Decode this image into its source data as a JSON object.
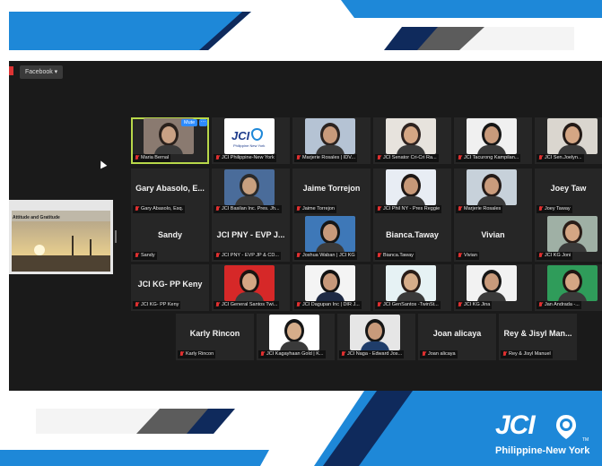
{
  "toolbar": {
    "facebook_label": "Facebook ▾"
  },
  "shared_screen": {
    "slide_title": "Attitude and Gratitude"
  },
  "tiles": [
    {
      "label": "Maria Bernal",
      "active": true,
      "mute": "Mute",
      "more": "···"
    },
    {
      "label": "JCI Philippine-New York"
    },
    {
      "label": "Marjerie Rosales | IDV..."
    },
    {
      "label": "JCI Senator Cri-Cri Ra..."
    },
    {
      "label": "JCI Tacurong Kampilan..."
    },
    {
      "label": "JCI Sen.Joelyn..."
    },
    {
      "big": "Gary Abasolo, E...",
      "label": "Gary Abasolo, Esq."
    },
    {
      "label": "JCI Basilan Inc. Pres. Jh..."
    },
    {
      "big": "Jaime Torrejon",
      "label": "Jaime Torrejon"
    },
    {
      "label": "JCI Phil NY - Pres Reggie"
    },
    {
      "label": "Marjerie Rosales"
    },
    {
      "big": "Joey Taw",
      "label": "Joey Taway"
    },
    {
      "big": "Sandy",
      "label": "Sandy"
    },
    {
      "big": "JCI PNY - EVP J...",
      "label": "JCI PNY - EVP JP & CD..."
    },
    {
      "label": "Joshua Waban | JCI KG"
    },
    {
      "big": "Bianca.Taway",
      "label": "Bianca.Taway"
    },
    {
      "big": "Vivian",
      "label": "Vivian"
    },
    {
      "label": "JCI KG Joni"
    },
    {
      "big": "JCI KG- PP Keny",
      "label": "JCI KG- PP Keny"
    },
    {
      "label": "JCI General Santos Twi..."
    },
    {
      "label": "JCI Dagupan Inc | DIR J..."
    },
    {
      "label": "JCI GenSantos -TwinSt..."
    },
    {
      "label": "JCI KG Jina"
    },
    {
      "label": "Jan Andrada -..."
    },
    {
      "big": "Karly Rincon",
      "label": "Karly Rincon"
    },
    {
      "label": "JCI Kagayhaan Gold | K..."
    },
    {
      "label": "JCI Naga - Edward Jos..."
    },
    {
      "big": "Joan alicaya",
      "label": "Joan alicaya"
    },
    {
      "big": "Rey & Jisyl Man...",
      "label": "Rey & Jisyl Manuel"
    }
  ],
  "jci_mini": {
    "text": "JCI",
    "sub": "Philippine New York"
  },
  "brand": {
    "logo_text": "JCI",
    "tagline": "Philippine-New York",
    "tm": "TM"
  },
  "colors": {
    "blue": "#1e88d8",
    "navy": "#0f2a5c",
    "grey": "#5c5c5c",
    "active": "#b8d84a",
    "zoom_bg": "#1a1a1a",
    "tile_bg": "#262626",
    "mute": "#2d8cff"
  }
}
